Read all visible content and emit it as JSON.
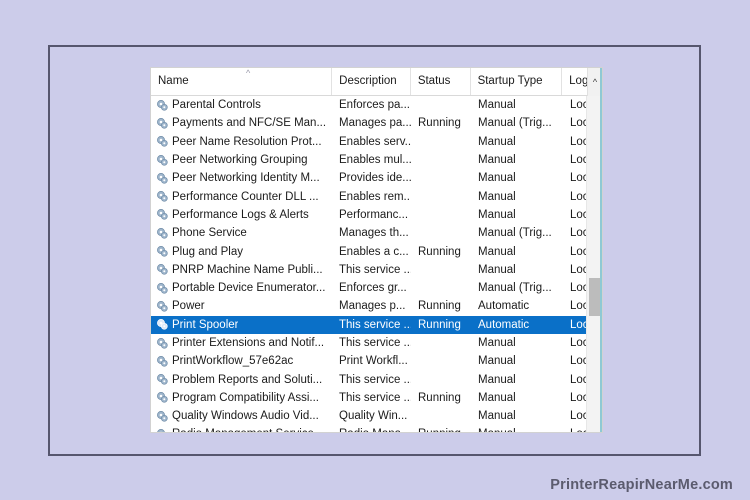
{
  "window": {
    "background_color": "#ccccea",
    "frame_border_color": "#56566e"
  },
  "list": {
    "accent_color": "#0a70c8",
    "sort_caret": "^",
    "scroll_up_caret": "^",
    "columns": [
      {
        "key": "name",
        "label": "Name"
      },
      {
        "key": "desc",
        "label": "Description"
      },
      {
        "key": "status",
        "label": "Status"
      },
      {
        "key": "start",
        "label": "Startup Type"
      },
      {
        "key": "log",
        "label": "Log"
      }
    ],
    "rows": [
      {
        "icon": "service-gear-icon",
        "name": "Parental Controls",
        "desc": "Enforces pa...",
        "status": "",
        "start": "Manual",
        "log": "Loc",
        "selected": false
      },
      {
        "icon": "service-gear-icon",
        "name": "Payments and NFC/SE Man...",
        "desc": "Manages pa...",
        "status": "Running",
        "start": "Manual (Trig...",
        "log": "Loc",
        "selected": false
      },
      {
        "icon": "service-gear-icon",
        "name": "Peer Name Resolution Prot...",
        "desc": "Enables serv...",
        "status": "",
        "start": "Manual",
        "log": "Loc",
        "selected": false
      },
      {
        "icon": "service-gear-icon",
        "name": "Peer Networking Grouping",
        "desc": "Enables mul...",
        "status": "",
        "start": "Manual",
        "log": "Loc",
        "selected": false
      },
      {
        "icon": "service-gear-icon",
        "name": "Peer Networking Identity M...",
        "desc": "Provides ide...",
        "status": "",
        "start": "Manual",
        "log": "Loc",
        "selected": false
      },
      {
        "icon": "service-gear-icon",
        "name": "Performance Counter DLL ...",
        "desc": "Enables rem...",
        "status": "",
        "start": "Manual",
        "log": "Loc",
        "selected": false
      },
      {
        "icon": "service-gear-icon",
        "name": "Performance Logs & Alerts",
        "desc": "Performanc...",
        "status": "",
        "start": "Manual",
        "log": "Loc",
        "selected": false
      },
      {
        "icon": "service-gear-icon",
        "name": "Phone Service",
        "desc": "Manages th...",
        "status": "",
        "start": "Manual (Trig...",
        "log": "Loc",
        "selected": false
      },
      {
        "icon": "service-gear-icon",
        "name": "Plug and Play",
        "desc": "Enables a c...",
        "status": "Running",
        "start": "Manual",
        "log": "Loc",
        "selected": false
      },
      {
        "icon": "service-gear-icon",
        "name": "PNRP Machine Name Publi...",
        "desc": "This service ...",
        "status": "",
        "start": "Manual",
        "log": "Loc",
        "selected": false
      },
      {
        "icon": "service-gear-icon",
        "name": "Portable Device Enumerator...",
        "desc": "Enforces gr...",
        "status": "",
        "start": "Manual (Trig...",
        "log": "Loc",
        "selected": false
      },
      {
        "icon": "service-gear-icon",
        "name": "Power",
        "desc": "Manages p...",
        "status": "Running",
        "start": "Automatic",
        "log": "Loc",
        "selected": false
      },
      {
        "icon": "service-gear-icon",
        "name": "Print Spooler",
        "desc": "This service ...",
        "status": "Running",
        "start": "Automatic",
        "log": "Loc",
        "selected": true
      },
      {
        "icon": "service-gear-icon",
        "name": "Printer Extensions and Notif...",
        "desc": "This service ...",
        "status": "",
        "start": "Manual",
        "log": "Loc",
        "selected": false
      },
      {
        "icon": "service-gear-icon",
        "name": "PrintWorkflow_57e62ac",
        "desc": "Print Workfl...",
        "status": "",
        "start": "Manual",
        "log": "Loc",
        "selected": false
      },
      {
        "icon": "service-gear-icon",
        "name": "Problem Reports and Soluti...",
        "desc": "This service ...",
        "status": "",
        "start": "Manual",
        "log": "Loc",
        "selected": false
      },
      {
        "icon": "service-gear-icon",
        "name": "Program Compatibility Assi...",
        "desc": "This service ...",
        "status": "Running",
        "start": "Manual",
        "log": "Loc",
        "selected": false
      },
      {
        "icon": "service-gear-icon",
        "name": "Quality Windows Audio Vid...",
        "desc": "Quality Win...",
        "status": "",
        "start": "Manual",
        "log": "Loc",
        "selected": false
      },
      {
        "icon": "service-gear-icon",
        "name": "Radio Management Service",
        "desc": "Radio Mana...",
        "status": "Running",
        "start": "Manual",
        "log": "Loc",
        "selected": false
      }
    ]
  },
  "footer": {
    "watermark": "PrinterReapirNearMe.com"
  }
}
